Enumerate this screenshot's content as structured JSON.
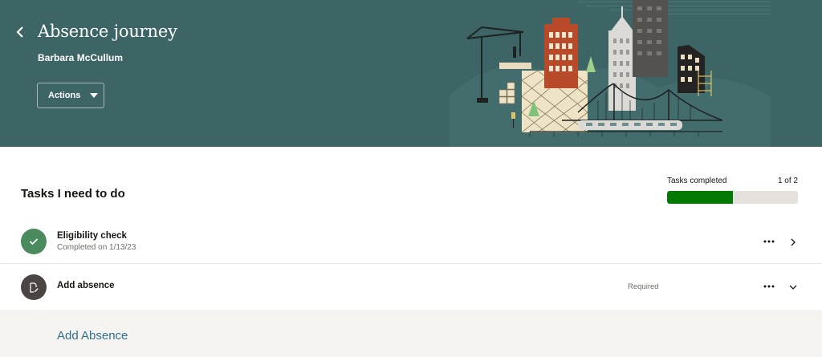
{
  "header": {
    "title": "Absence journey",
    "subtitle": "Barbara McCullum",
    "actions_label": "Actions",
    "background_color": "#3d6566",
    "back_icon": "chevron-left-icon"
  },
  "tasks_section": {
    "title": "Tasks I need to do",
    "progress": {
      "label": "Tasks completed",
      "count_text": "1 of 2",
      "completed": 1,
      "total": 2,
      "fill_color": "#047a04"
    },
    "tasks": [
      {
        "name": "Eligibility check",
        "subtext": "Completed on 1/13/23",
        "status": "",
        "icon": "checkmark-icon",
        "icon_color": "#4b8a5c"
      },
      {
        "name": "Add absence",
        "subtext": "",
        "status": "Required",
        "icon": "document-edit-icon",
        "icon_color": "#4a4542"
      }
    ],
    "expanded": {
      "link_label": "Add Absence"
    }
  }
}
